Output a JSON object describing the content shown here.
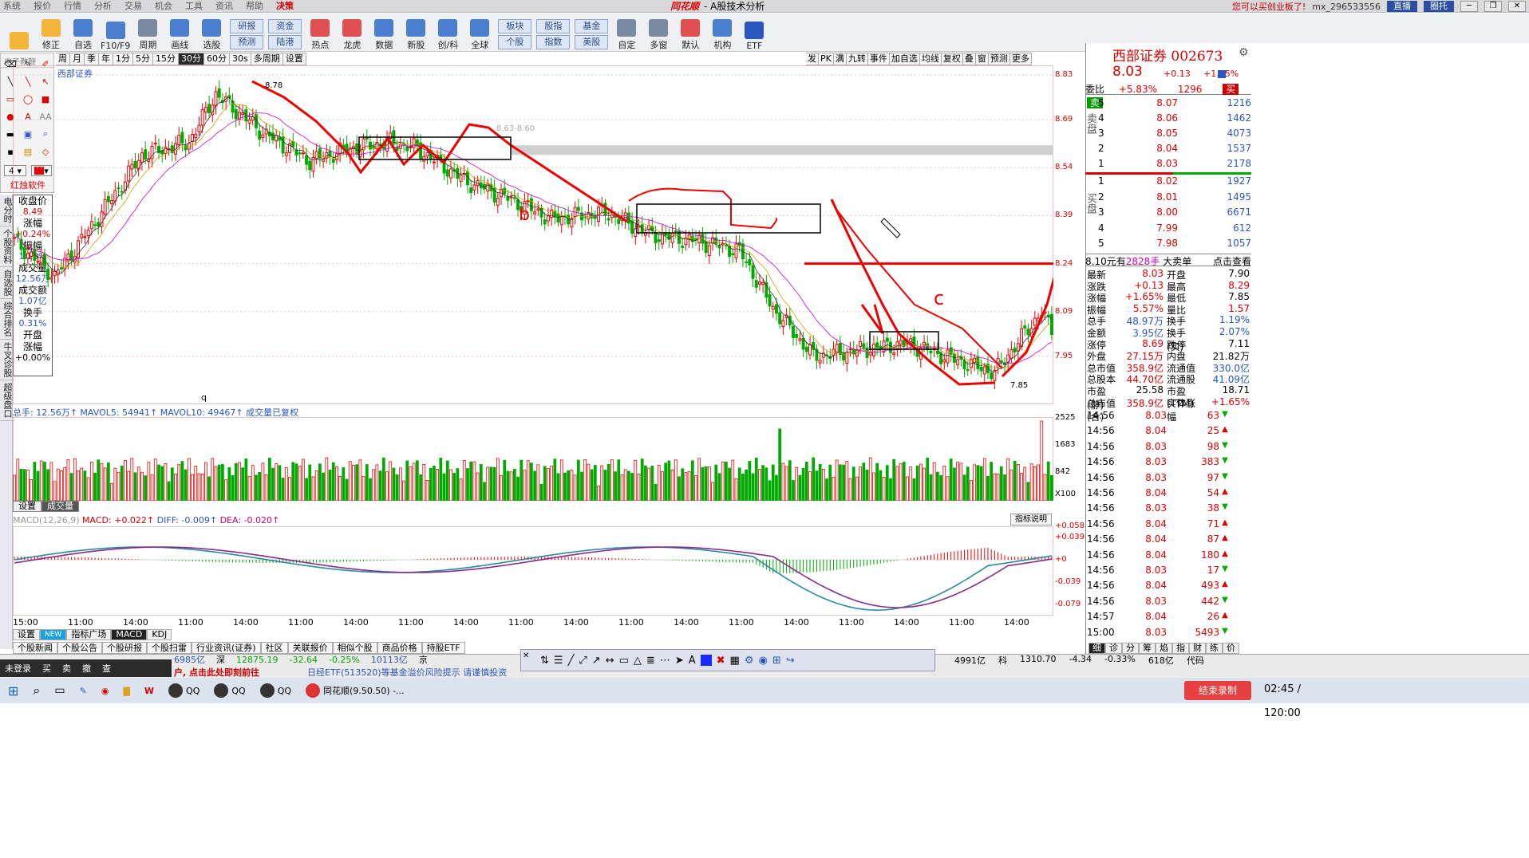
{
  "menu": [
    "系统",
    "报价",
    "行情",
    "分析",
    "交易",
    "机会",
    "工具",
    "资讯",
    "帮助",
    "决策"
  ],
  "menu_active": "决策",
  "title": {
    "brand": "同花顺",
    "text": "- A股技术分析"
  },
  "title_right": {
    "promo": "您可以买创业板了!",
    "user": "mx_296533556",
    "live": "直播",
    "other": "圈托"
  },
  "toolbar": [
    {
      "label": "",
      "color": "#f2b53a"
    },
    {
      "label": "修正",
      "color": "#f2b53a"
    },
    {
      "label": "自选",
      "color": "#4a7fd0"
    },
    {
      "label": "F10/F9",
      "color": "#4a7fd0"
    },
    {
      "label": "周期",
      "color": "#7a8aa0"
    },
    {
      "label": "画线",
      "color": "#4a7fd0"
    },
    {
      "label": "选股",
      "color": "#4a7fd0"
    }
  ],
  "toolbar_pairs": [
    {
      "top": "研报",
      "bottom": "预测"
    },
    {
      "top": "资金",
      "bottom": "陆港"
    }
  ],
  "toolbar2": [
    {
      "label": "热点",
      "color": "#e05050"
    },
    {
      "label": "龙虎",
      "color": "#e05050"
    },
    {
      "label": "数据",
      "color": "#4a7fd0"
    },
    {
      "label": "新股",
      "color": "#4a7fd0"
    },
    {
      "label": "创/科",
      "color": "#4a7fd0"
    },
    {
      "label": "全球",
      "color": "#4a7fd0"
    }
  ],
  "toolbar_pairs2": [
    {
      "top": "板块",
      "bottom": "个股"
    },
    {
      "top": "股指",
      "bottom": "指数"
    },
    {
      "top": "基金",
      "bottom": "美股"
    }
  ],
  "toolbar3": [
    {
      "label": "自定",
      "color": "#7a8aa0"
    },
    {
      "label": "多窗",
      "color": "#7a8aa0"
    },
    {
      "label": "默认",
      "color": "#e05050"
    },
    {
      "label": "机构",
      "color": "#4a7fd0"
    },
    {
      "label": "ETF",
      "color": "#2a56c0"
    }
  ],
  "palette_title": "电子教鞭",
  "palette_brand": "红烛软件",
  "vtabs": [
    "电分时",
    "个股资料",
    "自选股",
    "综合排名",
    "牛叉诊股",
    "超级盘口"
  ],
  "info": [
    {
      "k": "收盘价",
      "v": "8.49",
      "c": ""
    },
    {
      "k": "涨幅",
      "v": "+0.24%",
      "c": ""
    },
    {
      "k": "振幅",
      "v": "1.18%",
      "c": "blue"
    },
    {
      "k": "成交量",
      "v": "12.56万",
      "c": "blue"
    },
    {
      "k": "成交额",
      "v": "1.07亿",
      "c": "blue"
    },
    {
      "k": "换手",
      "v": "0.31%",
      "c": "blue"
    },
    {
      "k": "开盘",
      "v": "",
      "c": ""
    },
    {
      "k": "涨幅",
      "v": "+0.00%",
      "c": "blk"
    }
  ],
  "periods": [
    "周",
    "月",
    "季",
    "年",
    "1分",
    "5分",
    "15分",
    "30分",
    "60分",
    "30s",
    "多周期",
    "设置"
  ],
  "period_selected": "30分",
  "right_tools": [
    "发",
    "PK",
    "满",
    "九转",
    "事件",
    "加自选",
    "均线",
    "复权",
    "叠",
    "窗",
    "预测",
    "更多"
  ],
  "stock_tag": "西部证券",
  "price_axis": [
    "8.83",
    "8.69",
    "8.54",
    "8.39",
    "8.24",
    "8.09",
    "7.95"
  ],
  "annotations": {
    "high": "8.78",
    "low": "7.85",
    "zone": "8.63-8.60",
    "labels": [
      "b",
      "c",
      "a"
    ],
    "q": "q"
  },
  "vol_head": {
    "prefix": "总手: 12.56万↑",
    "ma5": "MAVOL5: 54941↑",
    "ma10": "MAVOL10: 49467↑",
    "note": "成交量已复权"
  },
  "vol_axis": [
    "2525",
    "1683",
    "842",
    "X100"
  ],
  "set_tabs": [
    "设置",
    "成交量"
  ],
  "macd_head": {
    "name": "MACD(12,26,9)",
    "macd": "MACD: +0.022↑",
    "diff": "DIFF: -0.009↑",
    "dea": "DEA: -0.020↑"
  },
  "index_btn": "指标说明",
  "macd_axis": [
    "+0.058",
    "+0.039",
    "+0",
    "-0.039",
    "-0.079"
  ],
  "time_axis": [
    "15:00",
    "11:00",
    "14:00",
    "11:00",
    "14:00",
    "11:00",
    "14:00",
    "11:00",
    "14:00",
    "11:00",
    "14:00",
    "11:00",
    "14:00",
    "11:00",
    "14:00",
    "11:00",
    "14:00",
    "11:00",
    "14:00"
  ],
  "bottom_tabs": [
    "设置",
    "NEW",
    "指标广场",
    "MACD",
    "KDJ"
  ],
  "news_tabs": [
    "个股新闻",
    "个股公告",
    "个股研报",
    "个股扫雷",
    "行业资讯(证券)",
    "社区",
    "关联报价",
    "相似个股",
    "商品价格",
    "持股ETF"
  ],
  "quote": {
    "name": "西部证券 002673",
    "price": "8.03",
    "chg": "+0.13",
    "pct": "+1.65%",
    "weibi_label": "委比",
    "weibi": "+5.83%",
    "weicha": "1296",
    "buy": "买",
    "sell": "卖",
    "sell_side": "卖盘",
    "buy_side": "买盘",
    "asks": [
      {
        "lv": "5",
        "p": "8.07",
        "q": "1216"
      },
      {
        "lv": "4",
        "p": "8.06",
        "q": "1462"
      },
      {
        "lv": "3",
        "p": "8.05",
        "q": "4073"
      },
      {
        "lv": "2",
        "p": "8.04",
        "q": "1537"
      },
      {
        "lv": "1",
        "p": "8.03",
        "q": "2178"
      }
    ],
    "bids": [
      {
        "lv": "1",
        "p": "8.02",
        "q": "1927"
      },
      {
        "lv": "2",
        "p": "8.01",
        "q": "1495"
      },
      {
        "lv": "3",
        "p": "8.00",
        "q": "6671"
      },
      {
        "lv": "4",
        "p": "7.99",
        "q": "612"
      },
      {
        "lv": "5",
        "p": "7.98",
        "q": "1057"
      }
    ],
    "bigorder": {
      "left": "8.10元有",
      "mid": "2828手",
      "label": "大卖单",
      "link": "点击查看"
    },
    "stats": [
      {
        "k1": "最新",
        "v1": "8.03",
        "k2": "开盘",
        "v2": "7.90",
        "c2": "blk"
      },
      {
        "k1": "涨跌",
        "v1": "+0.13",
        "k2": "最高",
        "v2": "8.29",
        "c2": ""
      },
      {
        "k1": "涨幅",
        "v1": "+1.65%",
        "k2": "最低",
        "v2": "7.85",
        "c2": "blk"
      },
      {
        "k1": "振幅",
        "v1": "5.57%",
        "k2": "量比",
        "v2": "1.57",
        "c2": ""
      },
      {
        "k1": "总手",
        "v1": "48.97万",
        "k2": "换手",
        "v2": "1.19%",
        "c2": "blue"
      },
      {
        "k1": "金额",
        "v1": "3.95亿",
        "k2": "换手(实)",
        "v2": "2.07%",
        "c2": "blue"
      },
      {
        "k1": "涨停",
        "v1": "8.69",
        "k2": "跌停",
        "v2": "7.11",
        "c2": "blk"
      },
      {
        "k1": "外盘",
        "v1": "27.15万",
        "k2": "内盘",
        "v2": "21.82万",
        "c2": "blk"
      },
      {
        "k1": "总市值",
        "v1": "358.9亿",
        "k2": "流通值",
        "v2": "330.0亿",
        "c2": "blue"
      },
      {
        "k1": "总股本",
        "v1": "44.70亿",
        "k2": "流通股",
        "v2": "41.09亿",
        "c2": "blue"
      },
      {
        "k1": "市盈(静)",
        "v1": "25.58",
        "k2": "市盈(TTM)",
        "v2": "18.71",
        "c2": "blk"
      },
      {
        "k1": "总市值(合)",
        "v1": "358.9亿",
        "k2": "实体涨幅",
        "v2": "+1.65%",
        "c2": ""
      }
    ],
    "trades": [
      {
        "t": "14:56",
        "p": "8.03",
        "v": "63",
        "d": "down"
      },
      {
        "t": "14:56",
        "p": "8.04",
        "v": "25",
        "d": "up"
      },
      {
        "t": "14:56",
        "p": "8.03",
        "v": "98",
        "d": "down"
      },
      {
        "t": "14:56",
        "p": "8.03",
        "v": "383",
        "d": "down"
      },
      {
        "t": "14:56",
        "p": "8.03",
        "v": "97",
        "d": "down"
      },
      {
        "t": "14:56",
        "p": "8.04",
        "v": "54",
        "d": "up"
      },
      {
        "t": "14:56",
        "p": "8.03",
        "v": "38",
        "d": "down"
      },
      {
        "t": "14:56",
        "p": "8.04",
        "v": "71",
        "d": "up"
      },
      {
        "t": "14:56",
        "p": "8.04",
        "v": "87",
        "d": "up"
      },
      {
        "t": "14:56",
        "p": "8.04",
        "v": "180",
        "d": "up"
      },
      {
        "t": "14:56",
        "p": "8.03",
        "v": "17",
        "d": "down"
      },
      {
        "t": "14:56",
        "p": "8.04",
        "v": "493",
        "d": "up"
      },
      {
        "t": "14:56",
        "p": "8.03",
        "v": "442",
        "d": "down"
      },
      {
        "t": "14:57",
        "p": "8.04",
        "v": "26",
        "d": "up"
      },
      {
        "t": "15:00",
        "p": "8.03",
        "v": "5493",
        "d": "down"
      }
    ],
    "tabs": [
      "细",
      "诊",
      "分",
      "筹",
      "焰",
      "指",
      "财",
      "练",
      "价"
    ]
  },
  "status": {
    "left": [
      "未登录",
      "买",
      "卖",
      "撤",
      "查"
    ],
    "ticker": [
      {
        "t": "6985亿",
        "c": "b"
      },
      {
        "t": "深",
        "c": ""
      },
      {
        "t": "12875.19",
        "c": "g"
      },
      {
        "t": "-32.64",
        "c": "g"
      },
      {
        "t": "-0.25%",
        "c": "g"
      },
      {
        "t": "10113亿",
        "c": "b"
      },
      {
        "t": "京",
        "c": ""
      }
    ],
    "news": [
      "户, 点击此处即刻前往",
      "日经ETF(513520)等基金溢价风险提示 请谨慎投资"
    ],
    "right": [
      "4991亿",
      "科",
      "1310.70",
      "-4.34",
      "-0.33%",
      "618亿"
    ],
    "code_label": "代码"
  },
  "taskbar": {
    "apps": [
      "QQ",
      "QQ",
      "QQ",
      "同花顺(9.50.50) -..."
    ],
    "timer": "02:45 / 120:00",
    "end": "结束录制"
  }
}
